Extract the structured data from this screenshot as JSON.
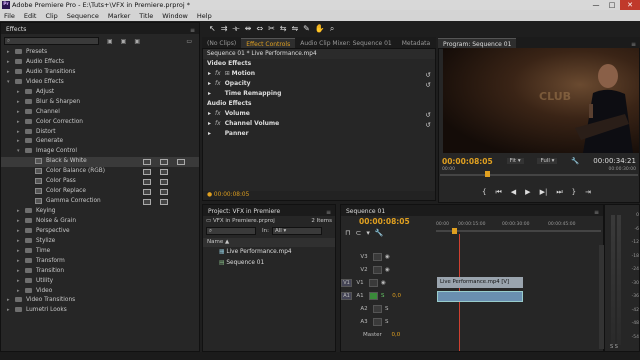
{
  "window": {
    "title": "Adobe Premiere Pro - E:\\Tuts+\\VFX in Premiere.prproj *",
    "app_icon": "Pr",
    "controls": [
      "—",
      "□",
      "✕"
    ]
  },
  "menu": [
    "File",
    "Edit",
    "Clip",
    "Sequence",
    "Marker",
    "Title",
    "Window",
    "Help"
  ],
  "effects_panel": {
    "tab": "Effects",
    "items": [
      {
        "label": "Presets",
        "level": 0,
        "expanded": false,
        "type": "folder"
      },
      {
        "label": "Audio Effects",
        "level": 0,
        "expanded": false,
        "type": "folder"
      },
      {
        "label": "Audio Transitions",
        "level": 0,
        "expanded": false,
        "type": "folder"
      },
      {
        "label": "Video Effects",
        "level": 0,
        "expanded": true,
        "type": "folder"
      },
      {
        "label": "Adjust",
        "level": 1,
        "expanded": false,
        "type": "folder"
      },
      {
        "label": "Blur & Sharpen",
        "level": 1,
        "expanded": false,
        "type": "folder"
      },
      {
        "label": "Channel",
        "level": 1,
        "expanded": false,
        "type": "folder"
      },
      {
        "label": "Color Correction",
        "level": 1,
        "expanded": false,
        "type": "folder"
      },
      {
        "label": "Distort",
        "level": 1,
        "expanded": false,
        "type": "folder"
      },
      {
        "label": "Generate",
        "level": 1,
        "expanded": false,
        "type": "folder"
      },
      {
        "label": "Image Control",
        "level": 1,
        "expanded": true,
        "type": "folder"
      },
      {
        "label": "Black & White",
        "level": 2,
        "type": "effect",
        "selected": true
      },
      {
        "label": "Color Balance (RGB)",
        "level": 2,
        "type": "effect"
      },
      {
        "label": "Color Pass",
        "level": 2,
        "type": "effect"
      },
      {
        "label": "Color Replace",
        "level": 2,
        "type": "effect"
      },
      {
        "label": "Gamma Correction",
        "level": 2,
        "type": "effect"
      },
      {
        "label": "Keying",
        "level": 1,
        "expanded": false,
        "type": "folder"
      },
      {
        "label": "Noise & Grain",
        "level": 1,
        "expanded": false,
        "type": "folder"
      },
      {
        "label": "Perspective",
        "level": 1,
        "expanded": false,
        "type": "folder"
      },
      {
        "label": "Stylize",
        "level": 1,
        "expanded": false,
        "type": "folder"
      },
      {
        "label": "Time",
        "level": 1,
        "expanded": false,
        "type": "folder"
      },
      {
        "label": "Transform",
        "level": 1,
        "expanded": false,
        "type": "folder"
      },
      {
        "label": "Transition",
        "level": 1,
        "expanded": false,
        "type": "folder"
      },
      {
        "label": "Utility",
        "level": 1,
        "expanded": false,
        "type": "folder"
      },
      {
        "label": "Video",
        "level": 1,
        "expanded": false,
        "type": "folder"
      },
      {
        "label": "Video Transitions",
        "level": 0,
        "expanded": false,
        "type": "folder"
      },
      {
        "label": "Lumetri Looks",
        "level": 0,
        "expanded": false,
        "type": "folder"
      }
    ]
  },
  "effect_controls": {
    "tabs": [
      "(No Clips)",
      "Effect Controls",
      "Audio Clip Mixer: Sequence 01",
      "Metadata"
    ],
    "clip_title": "Sequence 01 * Live Performance.mp4",
    "video_header": "Video Effects",
    "video_effects": [
      "Motion",
      "Opacity",
      "Time Remapping"
    ],
    "audio_header": "Audio Effects",
    "audio_effects": [
      "Volume",
      "Channel Volume",
      "Panner"
    ],
    "fx_label": "fx",
    "timecode": "00:00:08:05"
  },
  "program": {
    "tab": "Program: Sequence 01",
    "timecode": "00:00:08:05",
    "fit": "Fit",
    "quality": "Full",
    "duration": "00:00:34:21",
    "scene_text": "CLUB",
    "ruler_start": "00:00",
    "ruler_end": "00:00:30:00",
    "controls": [
      "⇤",
      "{",
      "⏮",
      "◀",
      "▶",
      "▶|",
      "⏭",
      "}",
      "⇥"
    ]
  },
  "project": {
    "tab": "Project: VFX in Premiere",
    "file": "VFX in Premiere.prproj",
    "count": "2 Items",
    "in_label": "In:",
    "in_value": "All",
    "column": "Name",
    "items": [
      "Live Performance.mp4",
      "Sequence 01"
    ]
  },
  "timeline": {
    "tab": "Sequence 01",
    "timecode": "00:00:08:05",
    "ruler": [
      "00:00",
      "00:00:15:00",
      "00:00:30:00",
      "00:00:45:00"
    ],
    "video_tracks": [
      "V3",
      "V2",
      "V1"
    ],
    "audio_tracks": [
      "A1",
      "A2",
      "A3"
    ],
    "master": "Master",
    "master_value": "0,0",
    "clip_label": "Live Performance.mp4 [V]",
    "a1_value": "0,0",
    "source_v": "V1",
    "source_a": "A1"
  },
  "meter": {
    "labels": [
      "0",
      "-6",
      "-12",
      "-18",
      "-24",
      "-30",
      "-36",
      "-42",
      "-48",
      "-54"
    ],
    "footer": [
      "S",
      "S"
    ]
  },
  "colors": {
    "accent": "#e0a020",
    "clip_video": "#9aa4ae",
    "clip_audio": "#6a8fb0",
    "playhead": "#d04030"
  }
}
